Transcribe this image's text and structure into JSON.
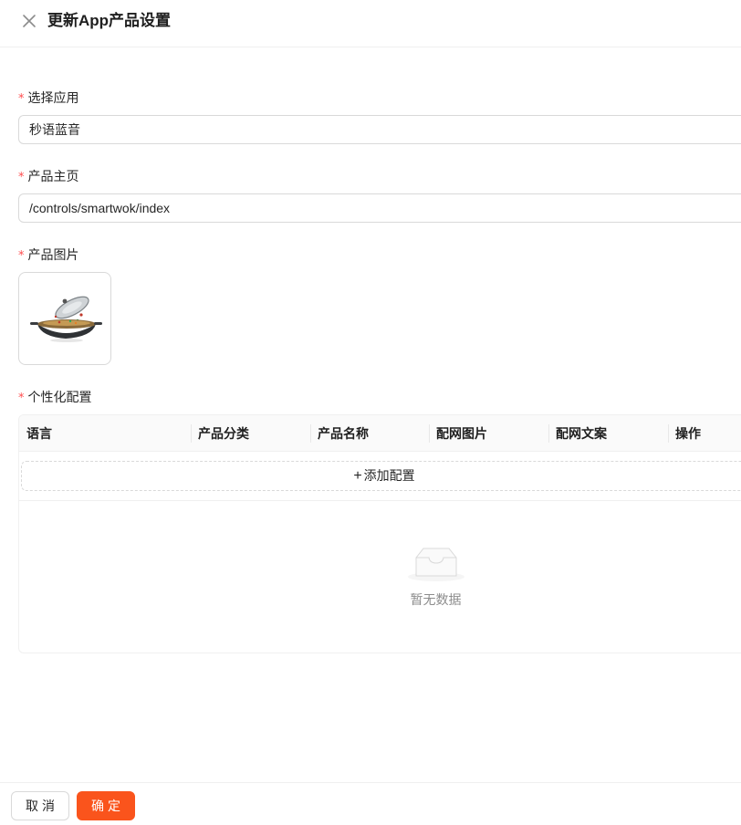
{
  "header": {
    "title": "更新App产品设置",
    "close_icon": "close-icon"
  },
  "form": {
    "required_mark": "*",
    "app": {
      "label": "选择应用",
      "value": "秒语蓝音"
    },
    "homepage": {
      "label": "产品主页",
      "value": "/controls/smartwok/index"
    },
    "image": {
      "label": "产品图片",
      "image_icon": "wok-pan-image"
    },
    "config": {
      "label": "个性化配置",
      "columns": [
        "语言",
        "产品分类",
        "产品名称",
        "配网图片",
        "配网文案",
        "操作"
      ],
      "add_label": "添加配置",
      "add_icon": "plus-icon",
      "empty_text": "暂无数据",
      "empty_icon": "empty-inbox-icon"
    }
  },
  "footer": {
    "cancel_label": "取消",
    "ok_label": "确定"
  },
  "colors": {
    "accent": "#fa541c",
    "required": "#ff4d4f",
    "border": "#d9d9d9"
  }
}
